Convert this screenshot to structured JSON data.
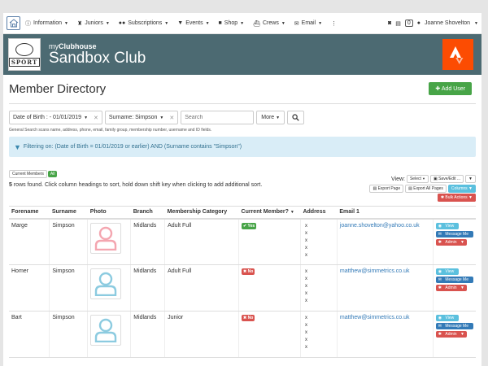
{
  "nav": {
    "items": [
      {
        "icon": "info-icon",
        "label": "Information"
      },
      {
        "icon": "trophy-icon",
        "label": "Juniors"
      },
      {
        "icon": "users-icon",
        "label": "Subscriptions"
      },
      {
        "icon": "filter-icon",
        "label": "Events"
      },
      {
        "icon": "lock-icon",
        "label": "Shop"
      },
      {
        "icon": "ship-icon",
        "label": "Crews"
      },
      {
        "icon": "envelope-icon",
        "label": "Email"
      }
    ],
    "counter": "0",
    "user_name": "Joanne Shovelton"
  },
  "header": {
    "logo_text": "SPORT",
    "brand_prefix": "my",
    "brand_bold": "Clubhouse",
    "club_name": "Sandbox Club"
  },
  "page": {
    "title": "Member Directory",
    "add_user": "Add User"
  },
  "filters": {
    "dob_chip": "Date of Birth : - 01/01/2019",
    "surname_chip": "Surname: Simpson",
    "search_placeholder": "Search",
    "more": "More",
    "hint": "General Search scans name, address, phone, email, family group, membership number, username and ID fields.",
    "active_filter": "Filtering on: (Date of Birth = 01/01/2019 or earlier) AND (Surname contains \"Simpson\")"
  },
  "list": {
    "toggle_current": "Current Members",
    "toggle_all": "All",
    "rows_found": "5",
    "rows_found_text": " rows found. Click column headings to sort, hold down shift key when clicking to add additional sort.",
    "view_label": "View:",
    "select_label": "Select",
    "save_edit": "Save/Edit ...",
    "export_page": "Export Page",
    "export_all": "Export All Pages",
    "columns": "Columns",
    "bulk_actions": "Bulk Actions"
  },
  "table": {
    "headers": [
      "Forename",
      "Surname",
      "Photo",
      "Branch",
      "Membership Category",
      "Current Member?",
      "Address",
      "Email 1",
      ""
    ],
    "rows": [
      {
        "forename": "Marge",
        "surname": "Simpson",
        "branch": "Midlands",
        "category": "Adult Full",
        "current": "Yes",
        "email": "joanne.shovelton@yahoo.co.uk",
        "avatar_color": "#f4a6b0"
      },
      {
        "forename": "Homer",
        "surname": "Simpson",
        "branch": "Midlands",
        "category": "Adult Full",
        "current": "No",
        "email": "matthew@simmetrics.co.uk",
        "avatar_color": "#8ccbe0"
      },
      {
        "forename": "Bart",
        "surname": "Simpson",
        "branch": "Midlands",
        "category": "Junior",
        "current": "No",
        "email": "matthew@simmetrics.co.uk",
        "avatar_color": "#8ccbe0"
      }
    ],
    "address_mark": "x",
    "actions": {
      "view": "View",
      "message": "Message Me",
      "admin": "Admin"
    }
  },
  "colors": {
    "header_bg": "#4c6a72",
    "strava": "#fc4c02",
    "success": "#47a447",
    "danger": "#d9534f",
    "info": "#5bc0de",
    "primary": "#337ab7"
  }
}
